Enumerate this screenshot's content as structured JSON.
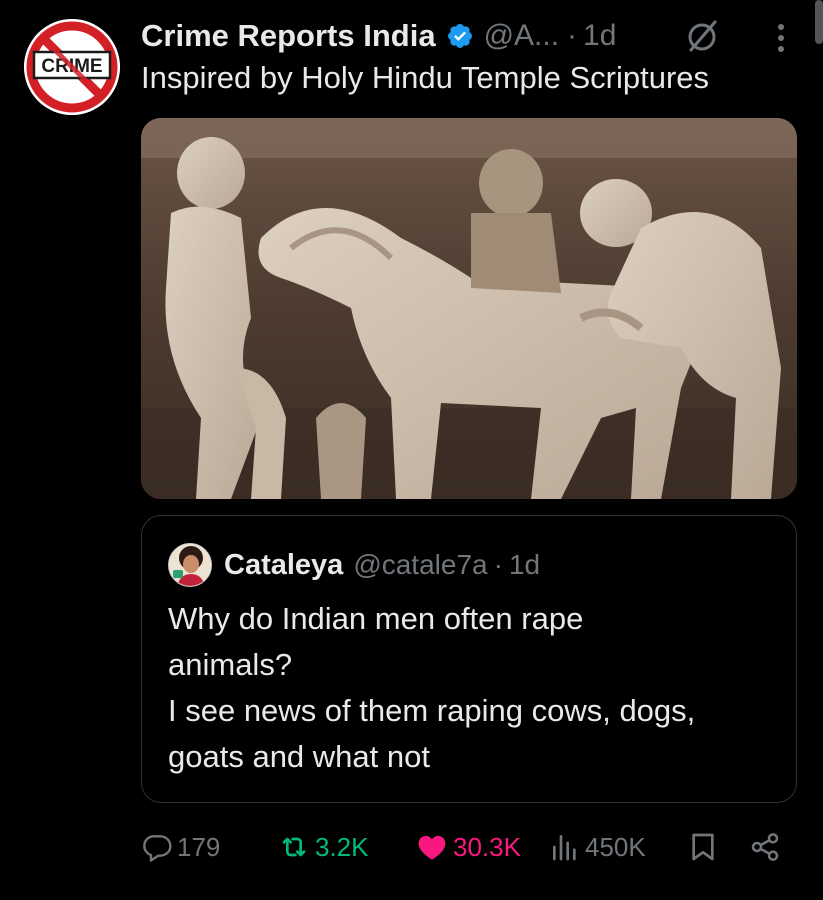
{
  "post": {
    "author_name": "Crime Reports India",
    "handle": "@A...",
    "separator": "·",
    "time": "1d",
    "text": "Inspired by Holy Hindu Temple Scriptures",
    "avatar_badge": "CRIME",
    "verified_color": "#1d9bf0",
    "media": {
      "icon": "photo"
    }
  },
  "quote": {
    "author_name": "Cataleya",
    "handle": "@catale7a",
    "separator": "·",
    "time": "1d",
    "lines": [
      "Why do Indian men often rape",
      "animals?",
      "I see news of them raping cows, dogs,",
      "goats and what not"
    ]
  },
  "actions": {
    "replies": "179",
    "retweets": "3.2K",
    "likes": "30.3K",
    "views": "450K",
    "retweet_color": "#00ba7c",
    "like_color": "#f91880",
    "muted_color": "#71767b"
  }
}
